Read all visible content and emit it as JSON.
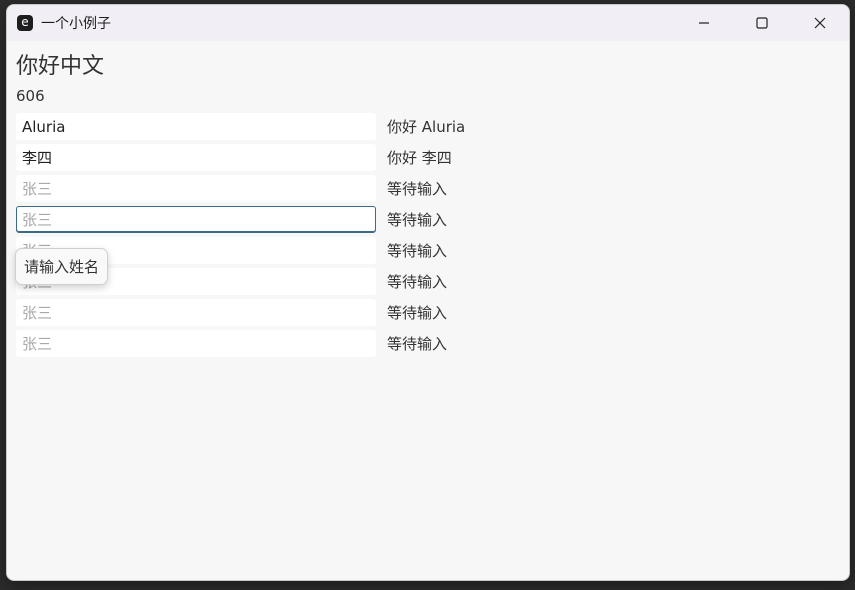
{
  "window": {
    "title": "一个小例子",
    "app_icon": "e"
  },
  "page": {
    "heading": "你好中文",
    "counter": "606"
  },
  "rows": [
    {
      "value": "Aluria",
      "placeholder": "张三",
      "greeting": "你好 Aluria"
    },
    {
      "value": "李四",
      "placeholder": "张三",
      "greeting": "你好 李四"
    },
    {
      "value": "",
      "placeholder": "张三",
      "greeting": "等待输入"
    },
    {
      "value": "",
      "placeholder": "张三",
      "greeting": "等待输入"
    },
    {
      "value": "",
      "placeholder": "张三",
      "greeting": "等待输入"
    },
    {
      "value": "",
      "placeholder": "张三",
      "greeting": "等待输入"
    },
    {
      "value": "",
      "placeholder": "张三",
      "greeting": "等待输入"
    },
    {
      "value": "",
      "placeholder": "张三",
      "greeting": "等待输入"
    }
  ],
  "tooltip": {
    "text": "请输入姓名"
  },
  "focused_row": 3
}
